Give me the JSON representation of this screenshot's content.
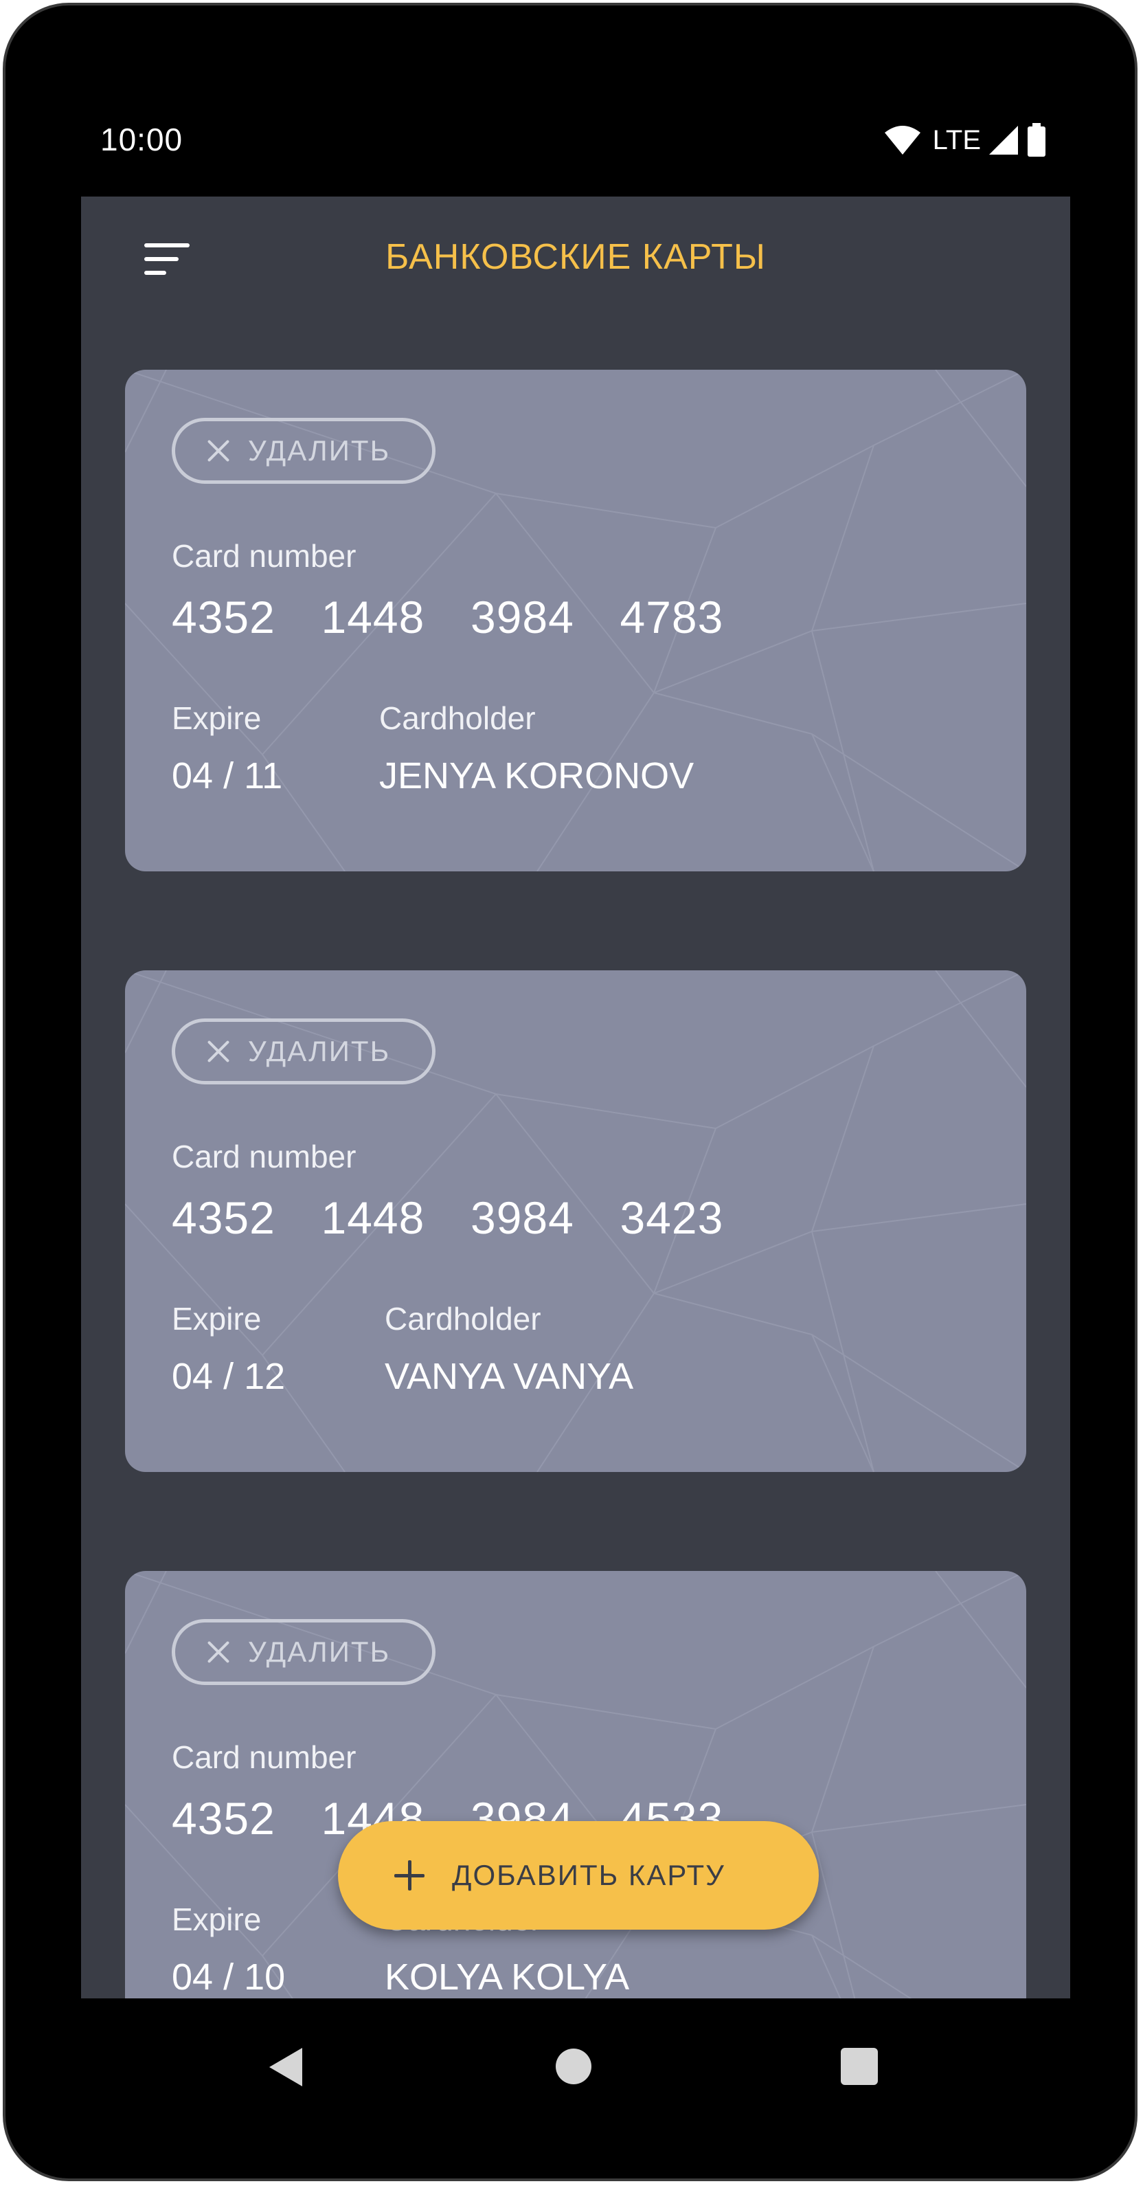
{
  "status_bar": {
    "time": "10:00",
    "network": "LTE",
    "icons": [
      "wifi-icon",
      "signal-icon",
      "battery-icon"
    ]
  },
  "app_bar": {
    "title": "БАНКОВСКИЕ КАРТЫ",
    "menu_icon": "menu-icon"
  },
  "colors": {
    "accent": "#f6c04a",
    "background": "#3a3d46",
    "card": "#878ba0"
  },
  "cards": [
    {
      "delete_label": "УДАЛИТЬ",
      "card_number_label": "Card number",
      "card_number": "4352  1448  3984  4783",
      "expire_label": "Expire",
      "expire": "04 / 11",
      "cardholder_label": "Cardholder",
      "cardholder": "JENYA KORONOV"
    },
    {
      "delete_label": "УДАЛИТЬ",
      "card_number_label": "Card number",
      "card_number": "4352  1448  3984  3423",
      "expire_label": "Expire",
      "expire": "04 / 12",
      "cardholder_label": "Cardholder",
      "cardholder": "VANYA VANYA"
    },
    {
      "delete_label": "УДАЛИТЬ",
      "card_number_label": "Card number",
      "card_number": "4352  1448  3984  4533",
      "expire_label": "Expire",
      "expire": "04 / 10",
      "cardholder_label": "Cardholder",
      "cardholder": "KOLYA KOLYA"
    }
  ],
  "fab": {
    "label": "ДОБАВИТЬ КАРТУ",
    "icon": "plus-icon"
  },
  "nav_bar": {
    "icons": [
      "back-icon",
      "home-icon",
      "recents-icon"
    ]
  }
}
